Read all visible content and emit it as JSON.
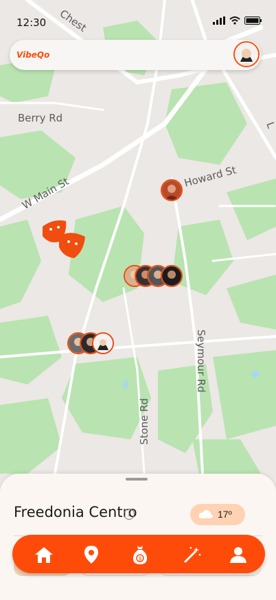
{
  "status_bar": {
    "time": "12:30"
  },
  "app": {
    "logo_text": "VibeQo",
    "accent": "#ff4b0a"
  },
  "map": {
    "streets": {
      "chestnut": "Chest",
      "berry": "Berry Rd",
      "main": "W Main St",
      "howard": "Howard St",
      "seymour": "Seymour Rd",
      "stone": "Stone Rd",
      "right_edge": "L"
    },
    "markers": [
      {
        "name": "single-user-marker",
        "count": 1
      },
      {
        "name": "theater-venue-marker",
        "icon": "theater-masks-icon"
      },
      {
        "name": "user-group-marker-center",
        "count": 4
      },
      {
        "name": "user-group-marker-lower",
        "count": 3
      }
    ]
  },
  "sheet": {
    "location_name": "Freedonia  Centro",
    "info_symbol": "i",
    "weather": {
      "temp": "17º",
      "icon": "cloud-icon"
    }
  },
  "bottom_nav": {
    "items": [
      {
        "icon": "home-icon"
      },
      {
        "icon": "map-pin-icon"
      },
      {
        "icon": "money-bag-icon"
      },
      {
        "icon": "magic-wand-icon"
      },
      {
        "icon": "profile-icon"
      }
    ]
  }
}
